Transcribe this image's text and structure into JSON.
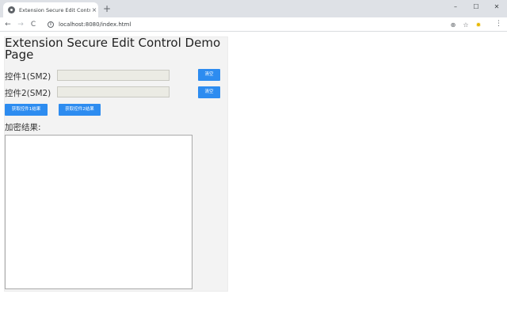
{
  "browser": {
    "tab_title": "Extension Secure Edit Control",
    "tab_close": "×",
    "new_tab": "+",
    "url": "localhost:8080/index.html",
    "window": {
      "minimize": "–",
      "maximize": "☐",
      "close": "✕"
    },
    "nav": {
      "back": "←",
      "forward": "→",
      "reload": "C"
    }
  },
  "page": {
    "title": "Extension Secure Edit Control Demo Page",
    "control1": {
      "label": "控件1(SM2)",
      "value": "",
      "clear_label": "清空"
    },
    "control2": {
      "label": "控件2(SM2)",
      "value": "",
      "clear_label": "清空"
    },
    "get1_label": "获取控件1结果",
    "get2_label": "获取控件2结果",
    "result_label": "加密结果:",
    "result_value": ""
  },
  "colors": {
    "primary_button": "#2d8cf0",
    "page_background": "#f3f3f3",
    "field_background": "#ebebe4"
  },
  "icons": [
    "favicon-icon",
    "close-icon",
    "plus-icon",
    "back-icon",
    "forward-icon",
    "reload-icon",
    "info-icon",
    "zoom-icon",
    "star-icon",
    "extension-icon",
    "menu-icon"
  ]
}
